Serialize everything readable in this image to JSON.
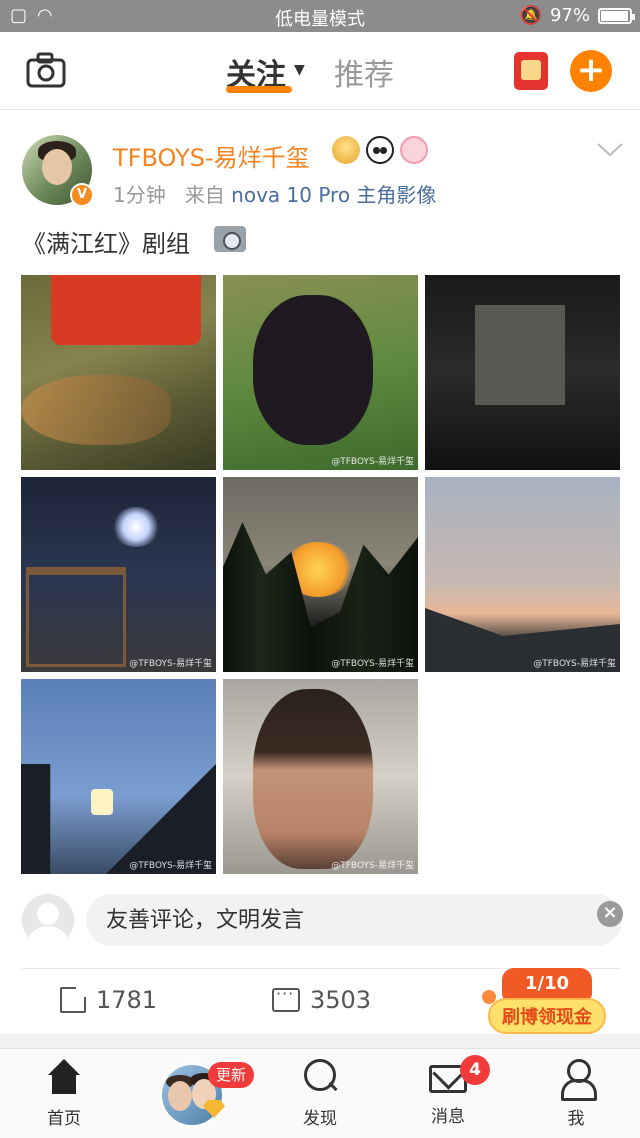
{
  "status_bar": {
    "mode_text": "低电量模式",
    "battery_percent": "97%",
    "battery_level": 0.97
  },
  "top_nav": {
    "tab_follow": "关注",
    "tab_recommend": "推荐",
    "icons": [
      "camera-icon",
      "red-packet-icon",
      "plus-icon"
    ]
  },
  "post": {
    "username": "TFBOYS-易烊千玺",
    "time": "1分钟",
    "source_prefix": "来自",
    "source": "nova 10 Pro 主角影像",
    "text": "《满江红》剧组",
    "verified_badge": "V",
    "images": [
      {
        "watermark": ""
      },
      {
        "watermark": "@TFBOYS-易烊千玺"
      },
      {
        "watermark": ""
      },
      {
        "watermark": "@TFBOYS-易烊千玺"
      },
      {
        "watermark": "@TFBOYS-易烊千玺"
      },
      {
        "watermark": "@TFBOYS-易烊千玺"
      },
      {
        "watermark": "@TFBOYS-易烊千玺"
      },
      {
        "watermark": "@TFBOYS-易烊千玺"
      }
    ]
  },
  "comment_box": {
    "placeholder": "友善评论，文明发言"
  },
  "actions": {
    "repost_count": "1781",
    "comment_count": "3503"
  },
  "cash_promo": {
    "progress": "1/10",
    "label": "刷博领现金"
  },
  "tab_bar": {
    "home": "首页",
    "update_badge": "更新",
    "discover": "发现",
    "messages": "消息",
    "messages_badge": "4",
    "me": "我"
  },
  "colors": {
    "accent": "#ff8200",
    "username": "#f5831f",
    "source_link": "#4a6e9a",
    "badge_red": "#f13b3b"
  }
}
